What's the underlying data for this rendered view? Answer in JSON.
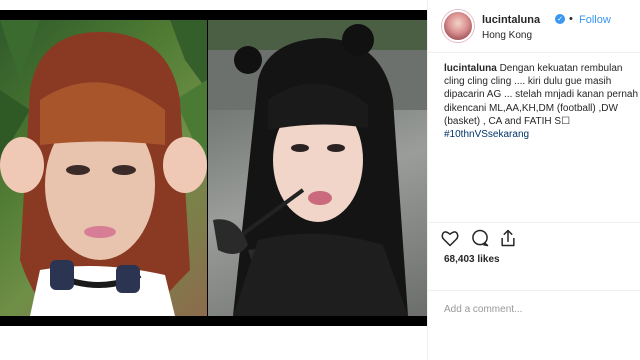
{
  "post": {
    "username": "lucintaluna",
    "follow_label": "Follow",
    "separator": "•",
    "location": "Hong Kong",
    "caption_user": "lucintaluna",
    "caption_lines": [
      "Dengan kekuatan rembulan",
      "cling cling cling .... kiri dulu gue masih",
      "dipacarin AG ... stelah mnjadi kanan pernah",
      "dikencani ML,AA,KH,DM (football) ,DW",
      "(basket) , CA and FATIH S☐"
    ],
    "hashtag": "#10thnVSsekarang",
    "likes": "68,403 likes",
    "comment_placeholder": "Add a comment..."
  },
  "icons": {
    "verified": "verified-badge-icon",
    "like": "heart-outline-icon",
    "comment": "comment-bubble-icon",
    "share": "share-upload-icon"
  },
  "colors": {
    "link_blue": "#3897f0",
    "hashtag_blue": "#003569",
    "text": "#262626",
    "muted": "#999999",
    "border": "#efefef"
  }
}
